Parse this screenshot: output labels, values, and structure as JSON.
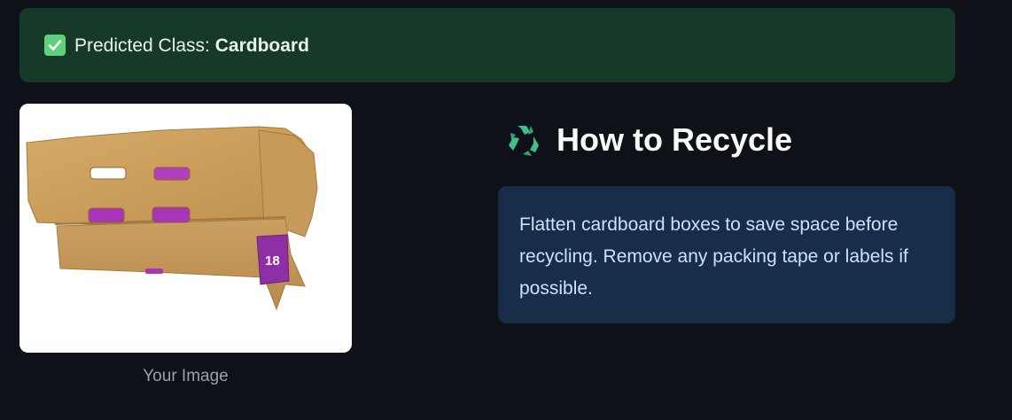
{
  "alert": {
    "prefix": "Predicted Class: ",
    "class_name": "Cardboard",
    "icon": "check-box-icon",
    "color": "#173928"
  },
  "image": {
    "caption": "Your Image",
    "subject": "flattened cardboard box photo",
    "label_on_box": "18"
  },
  "recycle": {
    "icon": "recycle-icon",
    "heading": "How to Recycle",
    "instructions": "Flatten cardboard boxes to save space before recycling. Remove any packing tape or labels if possible.",
    "box_color": "#172d48"
  }
}
